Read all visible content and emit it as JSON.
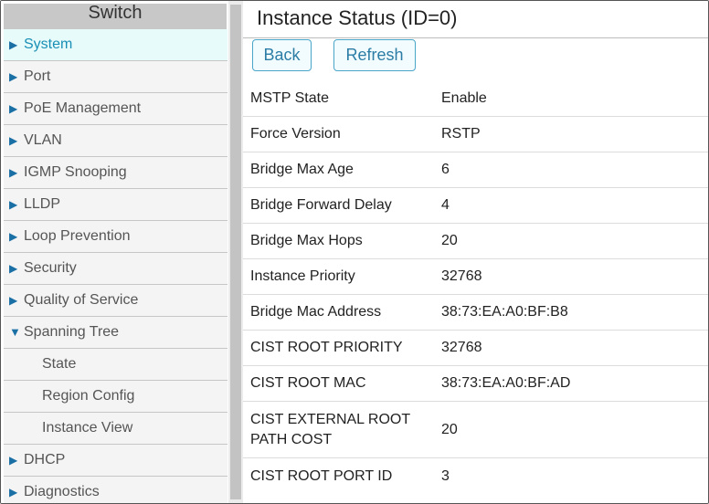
{
  "sidebar": {
    "title": "Switch",
    "items": [
      {
        "label": "System",
        "arrow": "▶"
      },
      {
        "label": "Port",
        "arrow": "▶"
      },
      {
        "label": "PoE Management",
        "arrow": "▶"
      },
      {
        "label": "VLAN",
        "arrow": "▶"
      },
      {
        "label": "IGMP Snooping",
        "arrow": "▶"
      },
      {
        "label": "LLDP",
        "arrow": "▶"
      },
      {
        "label": "Loop Prevention",
        "arrow": "▶"
      },
      {
        "label": "Security",
        "arrow": "▶"
      },
      {
        "label": "Quality of Service",
        "arrow": "▶"
      },
      {
        "label": "Spanning Tree",
        "arrow": "▼"
      },
      {
        "label": "DHCP",
        "arrow": "▶"
      },
      {
        "label": "Diagnostics",
        "arrow": "▶"
      }
    ],
    "subitems": [
      {
        "label": "State"
      },
      {
        "label": "Region Config"
      },
      {
        "label": "Instance View"
      }
    ]
  },
  "main": {
    "title": "Instance Status (ID=0)",
    "back_label": "Back",
    "refresh_label": "Refresh",
    "rows": [
      {
        "label": "MSTP State",
        "value": "Enable"
      },
      {
        "label": "Force Version",
        "value": "RSTP"
      },
      {
        "label": "Bridge Max Age",
        "value": "6"
      },
      {
        "label": "Bridge Forward Delay",
        "value": "4"
      },
      {
        "label": "Bridge Max Hops",
        "value": "20"
      },
      {
        "label": "Instance Priority",
        "value": "32768"
      },
      {
        "label": "Bridge Mac Address",
        "value": "38:73:EA:A0:BF:B8"
      },
      {
        "label": "CIST ROOT PRIORITY",
        "value": "32768"
      },
      {
        "label": "CIST ROOT MAC",
        "value": "38:73:EA:A0:BF:AD"
      },
      {
        "label": "CIST EXTERNAL ROOT PATH COST",
        "value": "20"
      },
      {
        "label": "CIST ROOT PORT ID",
        "value": "3"
      }
    ]
  },
  "colors": {
    "accent": "#1a8fb5",
    "button_border": "#4aa6c9",
    "sidebar_header": "#c8c8c8",
    "menu_bg": "#f4f4f4",
    "active_bg": "#e7fbfb"
  }
}
